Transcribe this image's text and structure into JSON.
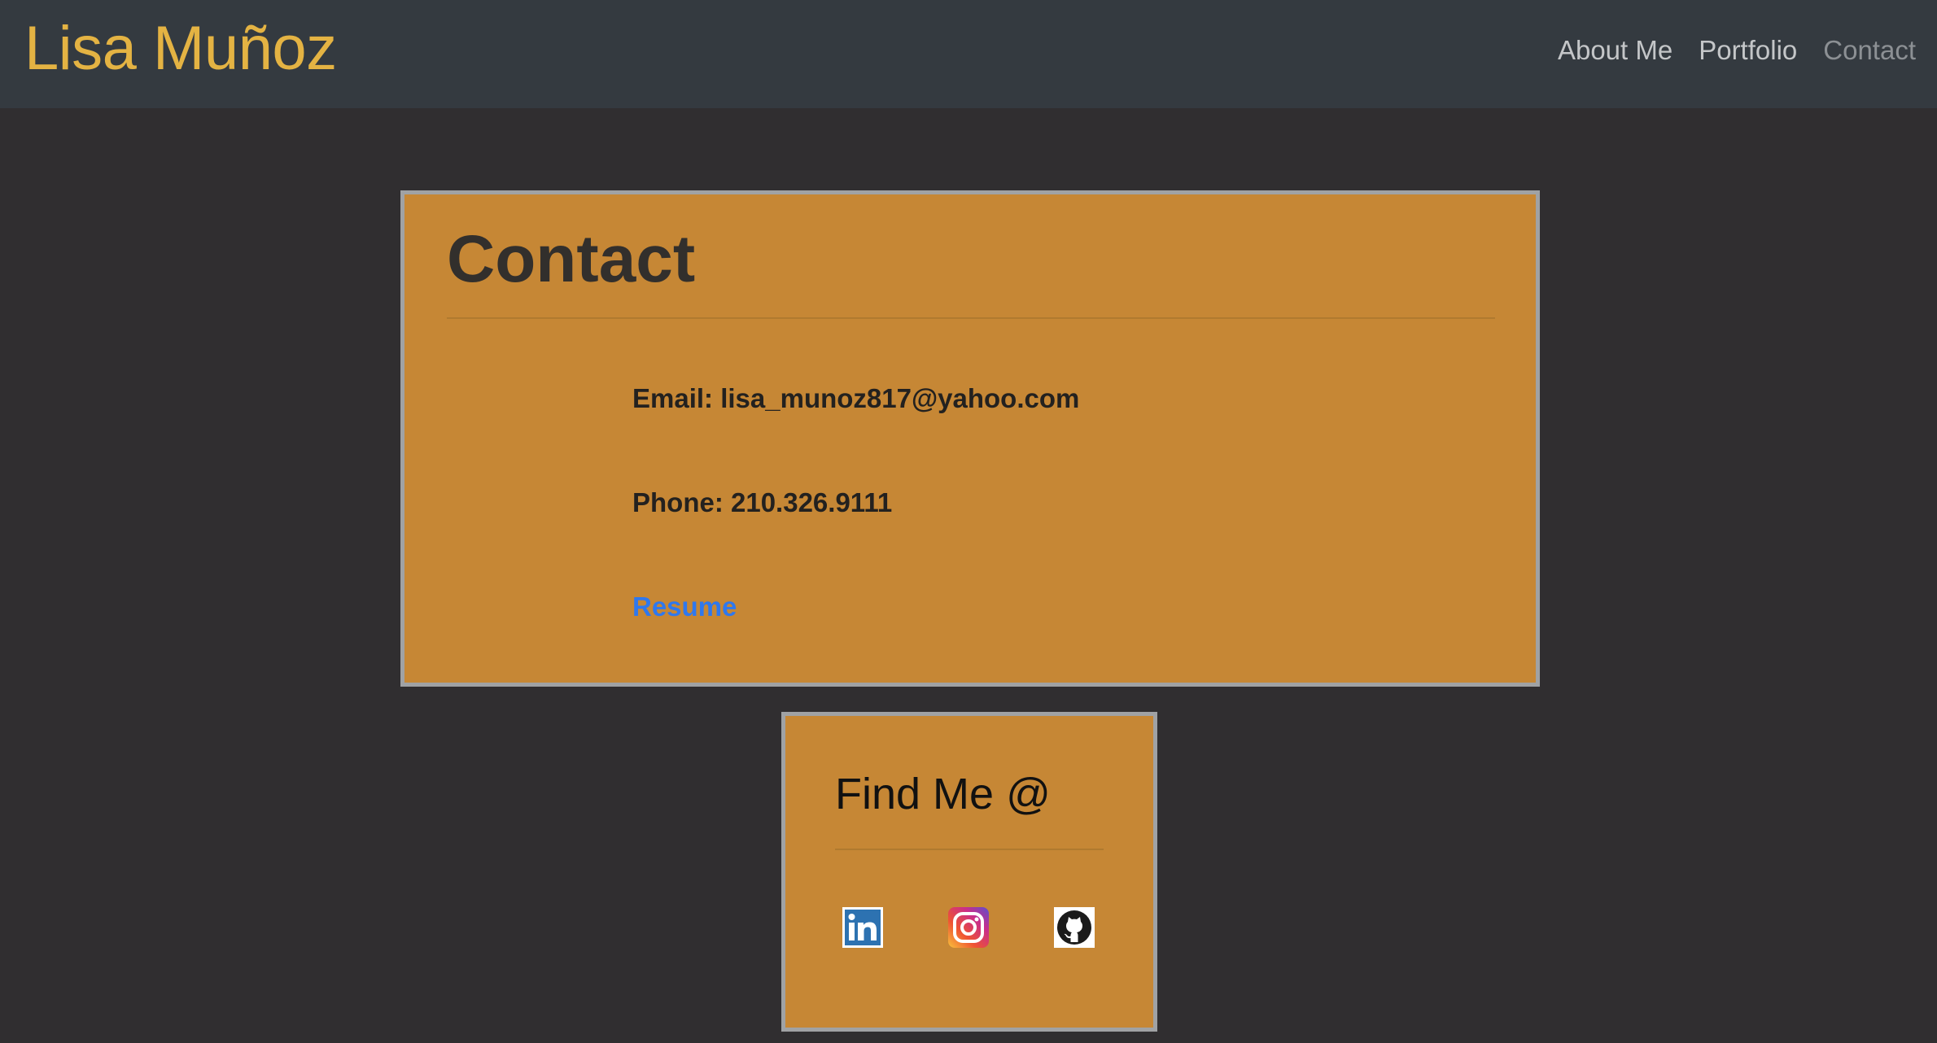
{
  "navbar": {
    "brand": "Lisa Muñoz",
    "links": [
      {
        "label": "About Me"
      },
      {
        "label": "Portfolio"
      },
      {
        "label": "Contact",
        "active": true
      }
    ]
  },
  "contact": {
    "title": "Contact",
    "email_line": "Email: lisa_munoz817@yahoo.com",
    "phone_line": "Phone: 210.326.9111",
    "resume_label": "Resume"
  },
  "find_me": {
    "title": "Find Me @",
    "icons": [
      {
        "name": "linkedin-icon"
      },
      {
        "name": "instagram-icon"
      },
      {
        "name": "github-icon"
      }
    ]
  },
  "colors": {
    "page_background": "#302e30",
    "navbar_background": "#343a40",
    "brand": "#e4b343",
    "card_background": "#c68735",
    "card_border": "#a0a2a4",
    "link": "#2f78ee"
  }
}
